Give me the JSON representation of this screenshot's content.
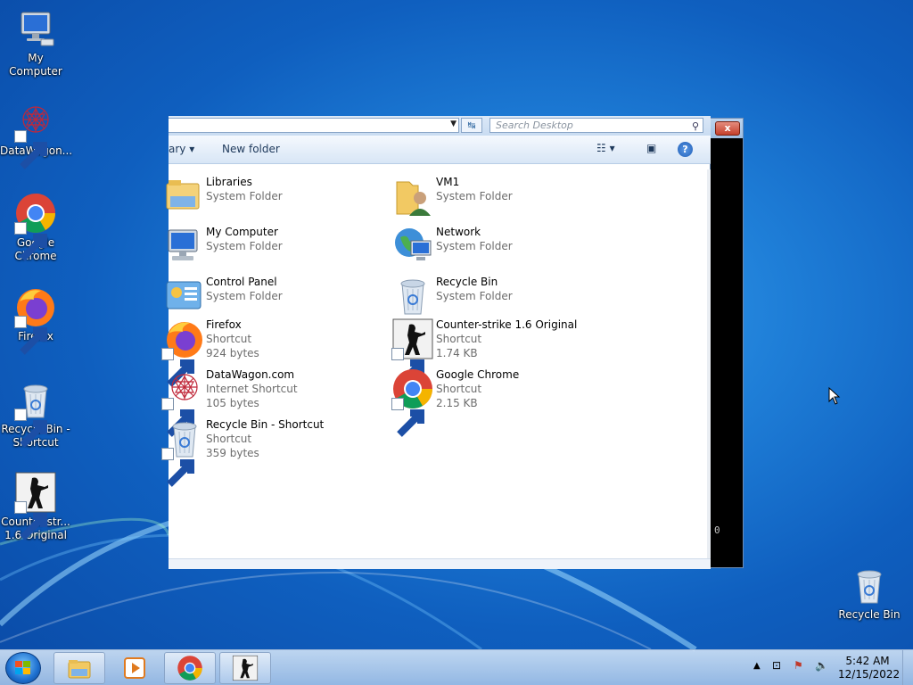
{
  "desktop": {
    "icons": [
      {
        "label": "My Computer"
      },
      {
        "label": "DataWagon..."
      },
      {
        "label": "Google Chrome"
      },
      {
        "label": "Firefox"
      },
      {
        "label": "Recycle Bin - Shortcut"
      },
      {
        "label": "Counter-str... 1.6 Original"
      },
      {
        "label": "Recycle Bin"
      }
    ]
  },
  "explorer": {
    "search_placeholder": "Search Desktop",
    "toolbar": {
      "library_label": "ary ▾",
      "new_folder_label": "New folder"
    },
    "items": [
      {
        "name": "Libraries",
        "type": "System Folder",
        "size": ""
      },
      {
        "name": "VM1",
        "type": "System Folder",
        "size": ""
      },
      {
        "name": "My Computer",
        "type": "System Folder",
        "size": ""
      },
      {
        "name": "Network",
        "type": "System Folder",
        "size": ""
      },
      {
        "name": "Control Panel",
        "type": "System Folder",
        "size": ""
      },
      {
        "name": "Recycle Bin",
        "type": "System Folder",
        "size": ""
      },
      {
        "name": "Firefox",
        "type": "Shortcut",
        "size": "924 bytes"
      },
      {
        "name": "Counter-strike 1.6 Original",
        "type": "Shortcut",
        "size": "1.74 KB"
      },
      {
        "name": "DataWagon.com",
        "type": "Internet Shortcut",
        "size": "105 bytes"
      },
      {
        "name": "Google Chrome",
        "type": "Shortcut",
        "size": "2.15 KB"
      },
      {
        "name": "Recycle Bin - Shortcut",
        "type": "Shortcut",
        "size": "359 bytes"
      }
    ]
  },
  "console": {
    "text": "0",
    "close_label": "x"
  },
  "taskbar": {
    "clock_time": "5:42 AM",
    "clock_date": "12/15/2022",
    "tray_arrow": "▲"
  },
  "colors": {
    "desktop_blue": "#1f7fd8",
    "taskbar": "#c8dcf2",
    "close_red": "#c5402b"
  }
}
